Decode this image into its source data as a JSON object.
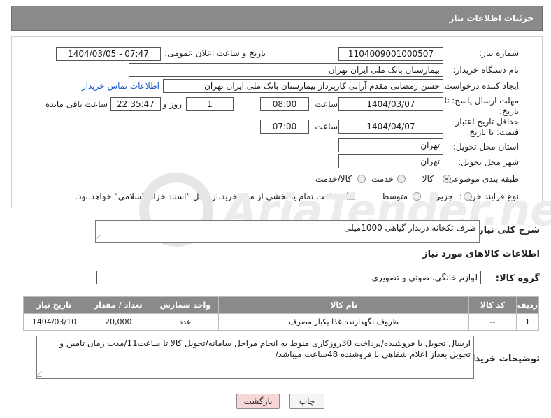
{
  "header": {
    "title": "جزئیات اطلاعات نیاز"
  },
  "fields": {
    "need_number_label": "شماره نیاز:",
    "need_number": "1104009001000507",
    "announce_label": "تاریخ و ساعت اعلان عمومی:",
    "announce_value": "1404/03/05 - 07:47",
    "buyer_org_label": "نام دستگاه خریدار:",
    "buyer_org": "بیمارستان بانک ملی ایران تهران",
    "creator_label": "ایجاد کننده درخواست:",
    "creator": "حسن رمضانی مقدم آرانی کارپرداز بیمارستان بانک ملی ایران تهران",
    "contact_link": "اطلاعات تماس خریدار",
    "deadline_label": "مهلت ارسال پاسخ: تا تاریخ:",
    "deadline_date": "1404/03/07",
    "time_label": "ساعت",
    "deadline_time": "08:00",
    "days_value": "1",
    "days_label": "روز و",
    "remaining_time": "22:35:47",
    "remaining_label": "ساعت باقی مانده",
    "validity_label": "حداقل تاریخ اعتبار قیمت: تا تاریخ:",
    "validity_date": "1404/04/07",
    "validity_time": "07:00",
    "province_label": "استان محل تحویل:",
    "province": "تهران",
    "city_label": "شهر محل تحویل:",
    "city": "تهران",
    "category_label": "طبقه بندی موضوعی:",
    "category_options": [
      "کالا",
      "خدمت",
      "کالا/خدمت"
    ],
    "purchase_type_label": "نوع فرآیند خرید :",
    "purchase_type_options": [
      "جزیی",
      "متوسط"
    ],
    "payment_note": "پرداخت تمام یا بخشی از مبلغ خرید،از محل \"اسناد خزانه اسلامی\" خواهد بود."
  },
  "description": {
    "label": "شرح کلی نیاز:",
    "value": "ظرف تکخانه دربدار گیاهی 1000میلی"
  },
  "goods_info_title": "اطلاعات کالاهای مورد نیاز",
  "goods_group": {
    "label": "گروه کالا:",
    "value": "لوازم خانگی، صوتی و تصویری"
  },
  "table": {
    "headers": [
      "ردیف",
      "کد کالا",
      "نام کالا",
      "واحد شمارش",
      "تعداد / مقدار",
      "تاریخ نیاز"
    ],
    "rows": [
      [
        "1",
        "--",
        "ظروف نگهدارنده غذا یکبار مصرف",
        "عدد",
        "20,000",
        "1404/03/10"
      ]
    ]
  },
  "buyer_notes": {
    "label": "توضیحات خریدار:",
    "value": "ارسال تحویل با فروشنده/پرداخت 30روزکاری منوط به انجام مراحل سامانه/تحویل کالا تا ساعت11/مدت زمان تامین و تحویل بعداز اعلام شفاهی با فروشنده 48ساعت میباشد/"
  },
  "buttons": {
    "print": "چاپ",
    "back": "بازگشت"
  },
  "watermark": {
    "text": "AriaTender.neT"
  },
  "colors": {
    "header_bg": "#8a8a8a",
    "link": "#1a58c7",
    "back_btn": "#f7d6d6",
    "print_btn": "#f4f4f4"
  }
}
